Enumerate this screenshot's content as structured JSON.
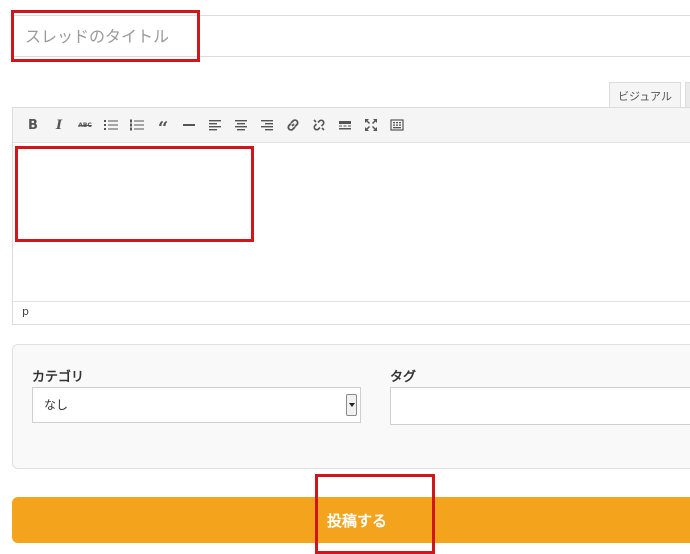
{
  "title_field": {
    "placeholder": "スレッドのタイトル",
    "value": ""
  },
  "editor": {
    "tabs": [
      {
        "label": "ビジュアル"
      },
      {
        "label": ""
      }
    ],
    "toolbar": [
      {
        "name": "bold-icon",
        "glyph": "B"
      },
      {
        "name": "italic-icon",
        "glyph": "I"
      },
      {
        "name": "strikethrough-icon",
        "glyph": "ABC"
      },
      {
        "name": "bullet-list-icon"
      },
      {
        "name": "numbered-list-icon"
      },
      {
        "name": "blockquote-icon",
        "glyph": "“"
      },
      {
        "name": "horizontal-rule-icon"
      },
      {
        "name": "align-left-icon"
      },
      {
        "name": "align-center-icon"
      },
      {
        "name": "align-right-icon"
      },
      {
        "name": "link-icon"
      },
      {
        "name": "unlink-icon"
      },
      {
        "name": "read-more-icon"
      },
      {
        "name": "fullscreen-icon"
      },
      {
        "name": "toolbar-toggle-icon"
      }
    ],
    "status_path": "p"
  },
  "meta": {
    "category_label": "カテゴリ",
    "category_selected": "なし",
    "tag_label": "タグ",
    "tag_value": ""
  },
  "submit_label": "投稿する",
  "colors": {
    "accent": "#f4a31c",
    "annotation": "#d0161b"
  }
}
